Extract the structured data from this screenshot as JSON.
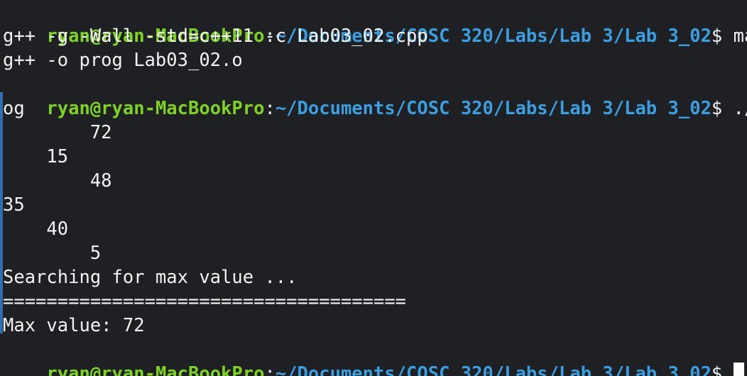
{
  "prompt": {
    "user_host": "ryan@ryan-MacBookPro",
    "separator": ":",
    "path": "~/Documents/COSC 320/Labs/Lab 3/Lab 3_02",
    "symbol": "$"
  },
  "commands": {
    "make": " mak",
    "run_part1": " ./p",
    "run_part2": "og"
  },
  "output": {
    "compile_line": "g++ -g -Wall -std=c++11 -c Lab03_02.cpp",
    "link_line": "g++ -o prog Lab03_02.o",
    "tree_lines": [
      "        72",
      "    15",
      "        48",
      "35",
      "    40",
      "        5"
    ],
    "searching": "Searching for max value ...",
    "divider": "=====================================",
    "max_value": "Max value: 72"
  }
}
